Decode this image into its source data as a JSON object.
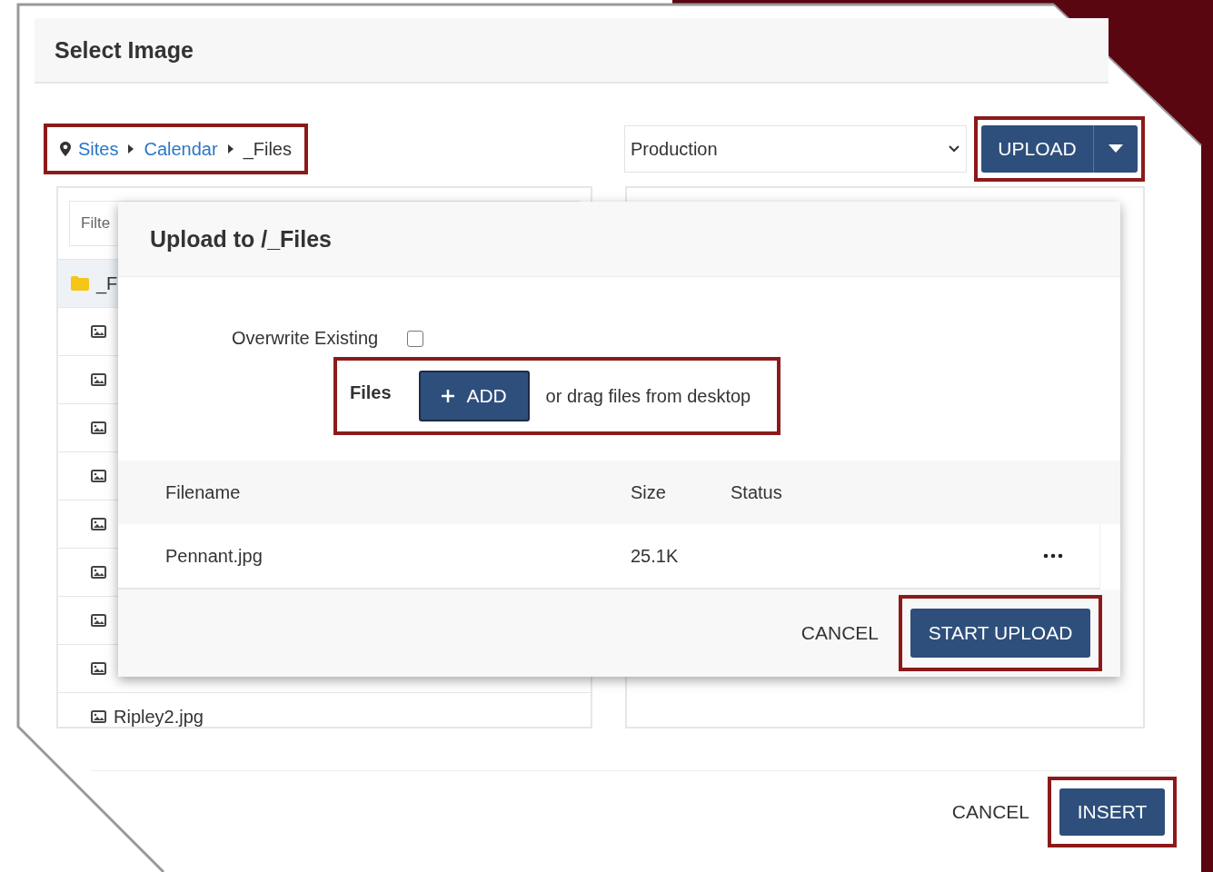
{
  "dialog": {
    "title": "Select Image"
  },
  "breadcrumb": [
    {
      "label": "Sites",
      "kind": "link"
    },
    {
      "label": "Calendar",
      "kind": "link"
    },
    {
      "label": "_Files",
      "kind": "current"
    }
  ],
  "environment_select": {
    "value": "Production"
  },
  "upload_button": {
    "label": "UPLOAD"
  },
  "file_browser": {
    "filter_placeholder": "Filte",
    "items": [
      {
        "label": "_F",
        "kind": "folder",
        "selected": true
      },
      {
        "kind": "image",
        "selected": false
      },
      {
        "kind": "image",
        "selected": false
      },
      {
        "kind": "image",
        "selected": false
      },
      {
        "kind": "image",
        "selected": false
      },
      {
        "kind": "image",
        "selected": false
      },
      {
        "kind": "image",
        "selected": false
      },
      {
        "kind": "image",
        "selected": false
      },
      {
        "kind": "image",
        "selected": false
      },
      {
        "label": "Ripley2.jpg",
        "kind": "image",
        "selected": false
      }
    ]
  },
  "upload_modal": {
    "title": "Upload to /_Files",
    "overwrite": {
      "label": "Overwrite Existing",
      "checked": false
    },
    "files_label": "Files",
    "add_button": "ADD",
    "add_hint": "or drag files from desktop",
    "columns": [
      "Filename",
      "Size",
      "Status"
    ],
    "rows": [
      {
        "filename": "Pennant.jpg",
        "size": "25.1K"
      }
    ],
    "cancel": "CANCEL",
    "start": "START UPLOAD"
  },
  "footer": {
    "cancel": "CANCEL",
    "insert": "INSERT"
  }
}
